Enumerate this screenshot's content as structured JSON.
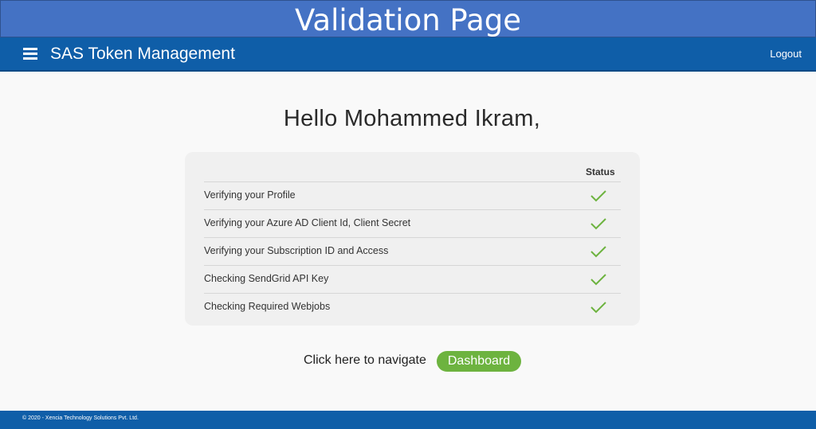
{
  "banner": {
    "title": "Validation Page"
  },
  "navbar": {
    "app_title": "SAS Token Management",
    "logout_label": "Logout",
    "menu_icon": "hamburger-menu-icon"
  },
  "greeting": "Hello Mohammed Ikram,",
  "validation": {
    "status_header": "Status",
    "items": [
      {
        "label": "Verifying your Profile",
        "status": "check-icon"
      },
      {
        "label": "Verifying your Azure AD Client Id, Client Secret",
        "status": "check-icon"
      },
      {
        "label": "Verifying your Subscription ID and Access",
        "status": "check-icon"
      },
      {
        "label": "Checking SendGrid API Key",
        "status": "check-icon"
      },
      {
        "label": "Checking Required Webjobs",
        "status": "check-icon"
      }
    ]
  },
  "navigate": {
    "text": "Click here to navigate",
    "button_label": "Dashboard"
  },
  "footer": {
    "copyright": "© 2020 - Xencia Technology Solutions Pvt. Ltd."
  },
  "colors": {
    "banner": "#4472c4",
    "navbar": "#0f5ea8",
    "success": "#6db33f",
    "card": "#f0f0f0"
  }
}
